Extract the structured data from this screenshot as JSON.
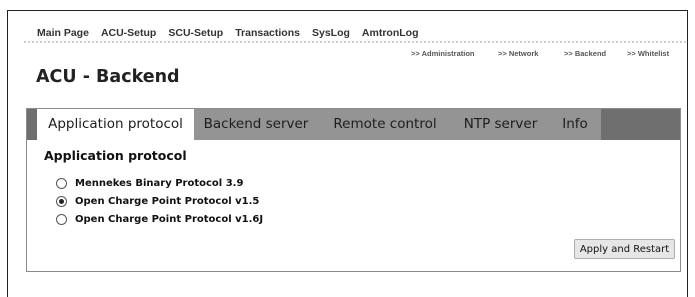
{
  "nav": {
    "items": [
      "Main Page",
      "ACU-Setup",
      "SCU-Setup",
      "Transactions",
      "SysLog",
      "AmtronLog"
    ]
  },
  "subnav": {
    "items": [
      ">> Administration",
      ">> Network",
      ">> Backend",
      ">> Whitelist"
    ]
  },
  "page": {
    "title": "ACU - Backend"
  },
  "tabs": [
    {
      "label": "Application protocol",
      "active": true
    },
    {
      "label": "Backend server",
      "active": false
    },
    {
      "label": "Remote control",
      "active": false
    },
    {
      "label": "NTP server",
      "active": false
    },
    {
      "label": "Info",
      "active": false
    }
  ],
  "section": {
    "title": "Application protocol",
    "options": [
      {
        "label": "Mennekes Binary Protocol 3.9",
        "checked": false
      },
      {
        "label": "Open Charge Point Protocol v1.5",
        "checked": true
      },
      {
        "label": "Open Charge Point Protocol v1.6J",
        "checked": false
      }
    ],
    "apply_label": "Apply and Restart"
  }
}
